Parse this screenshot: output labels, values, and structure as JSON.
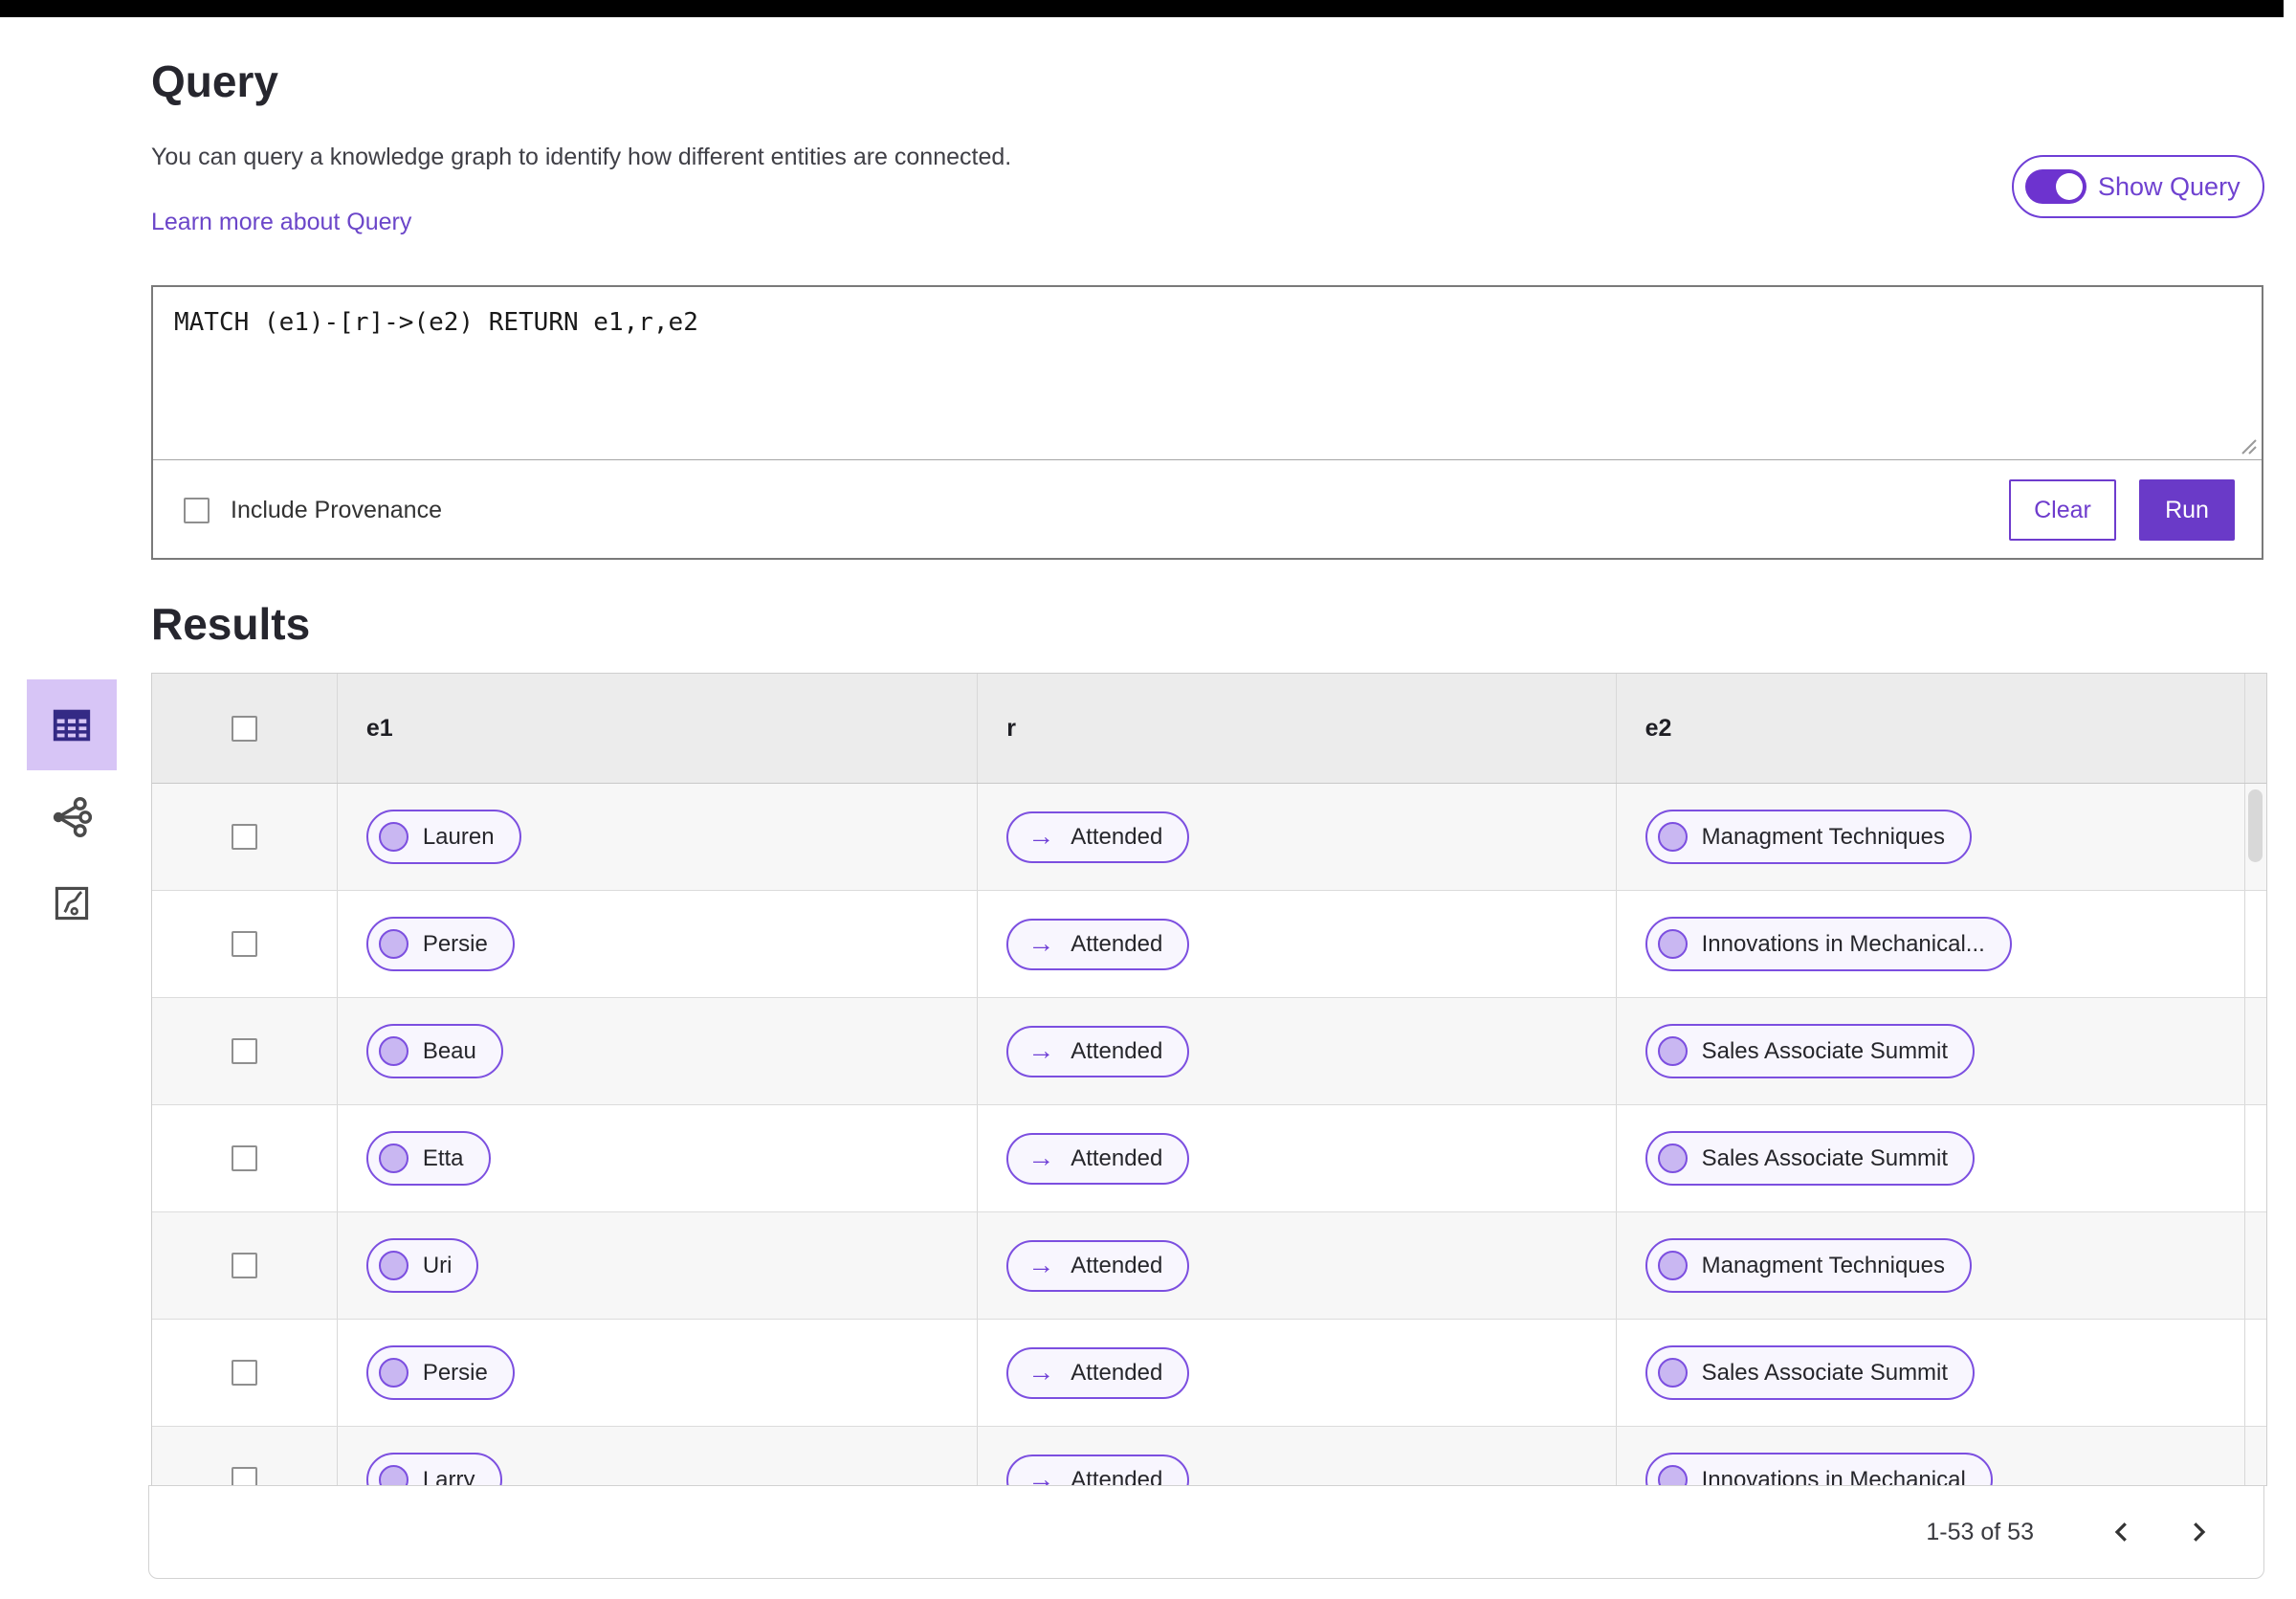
{
  "colors": {
    "accent_fill": "#6a3ac8",
    "accent_border": "#7c4fe0",
    "accent_text": "#6f42d0",
    "node_fill": "#c9b7f2",
    "pill_bg": "#f8f6fe",
    "selected_tile_bg": "#d7c5f6",
    "table_header_bg": "#ececec",
    "row_stripe_bg": "#f7f7f7"
  },
  "icons": {
    "arrow_right": "→",
    "table_view": "table-grid",
    "graph_view": "network-hub",
    "map_view": "route-map",
    "chevron_left": "angle-left",
    "chevron_right": "angle-right",
    "resize_handle": "diagonal-grip"
  },
  "query_section": {
    "title": "Query",
    "description": "You can query a knowledge graph to identify how different entities are connected.",
    "learn_more_label": "Learn more about Query",
    "show_query_label": "Show Query",
    "show_query_on": true,
    "query_text": "MATCH (e1)-[r]->(e2) RETURN e1,r,e2",
    "include_provenance_label": "Include Provenance",
    "include_provenance_checked": false,
    "clear_label": "Clear",
    "run_label": "Run"
  },
  "results_section": {
    "title": "Results",
    "table": {
      "columns": [
        "e1",
        "r",
        "e2"
      ],
      "select_all_checked": false,
      "rows": [
        {
          "e1": "Lauren",
          "r": "Attended",
          "e2": "Managment Techniques",
          "selected": false
        },
        {
          "e1": "Persie",
          "r": "Attended",
          "e2": "Innovations in Mechanical...",
          "selected": false
        },
        {
          "e1": "Beau",
          "r": "Attended",
          "e2": "Sales Associate Summit",
          "selected": false
        },
        {
          "e1": "Etta",
          "r": "Attended",
          "e2": "Sales Associate Summit",
          "selected": false
        },
        {
          "e1": "Uri",
          "r": "Attended",
          "e2": "Managment Techniques",
          "selected": false
        },
        {
          "e1": "Persie",
          "r": "Attended",
          "e2": "Sales Associate Summit",
          "selected": false
        },
        {
          "e1": "Larry",
          "r": "Attended",
          "e2": "Innovations in Mechanical",
          "selected": false
        }
      ]
    },
    "pagination": {
      "range_label": "1-53 of 53"
    }
  }
}
